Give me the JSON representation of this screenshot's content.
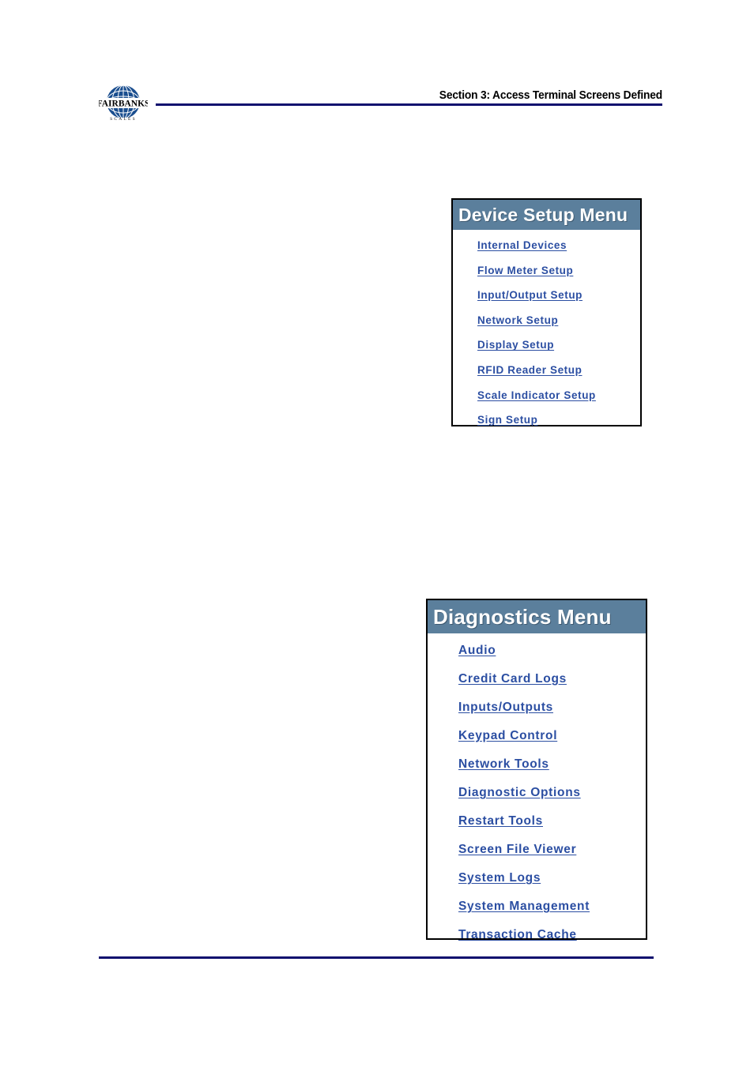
{
  "page": {
    "header_title": "Section 3:  Access Terminal Screens Defined",
    "logo_name": "FAIRBANKS",
    "logo_subtext": "S C A L E S",
    "rule_color": "#10106e",
    "background": "#ffffff"
  },
  "menus": [
    {
      "id": "device-setup-menu",
      "title": "Device Setup Menu",
      "header_bg": "#5b7f9c",
      "header_text_color": "#ffffff",
      "link_color": "#2b4ea2",
      "border_color": "#000000",
      "items": [
        {
          "label": "Internal Devices"
        },
        {
          "label": "Flow Meter Setup"
        },
        {
          "label": "Input/Output Setup"
        },
        {
          "label": "Network Setup"
        },
        {
          "label": "Display Setup"
        },
        {
          "label": "RFID Reader Setup"
        },
        {
          "label": "Scale Indicator Setup"
        },
        {
          "label": "Sign Setup"
        }
      ]
    },
    {
      "id": "diagnostics-menu",
      "title": "Diagnostics Menu",
      "header_bg": "#5b7f9c",
      "header_text_color": "#ffffff",
      "link_color": "#2b4ea2",
      "border_color": "#000000",
      "items": [
        {
          "label": "Audio"
        },
        {
          "label": "Credit Card Logs"
        },
        {
          "label": "Inputs/Outputs"
        },
        {
          "label": "Keypad Control"
        },
        {
          "label": "Network Tools"
        },
        {
          "label": "Diagnostic Options"
        },
        {
          "label": "Restart Tools"
        },
        {
          "label": "Screen File Viewer"
        },
        {
          "label": "System Logs"
        },
        {
          "label": "System Management"
        },
        {
          "label": "Transaction Cache"
        }
      ]
    }
  ]
}
